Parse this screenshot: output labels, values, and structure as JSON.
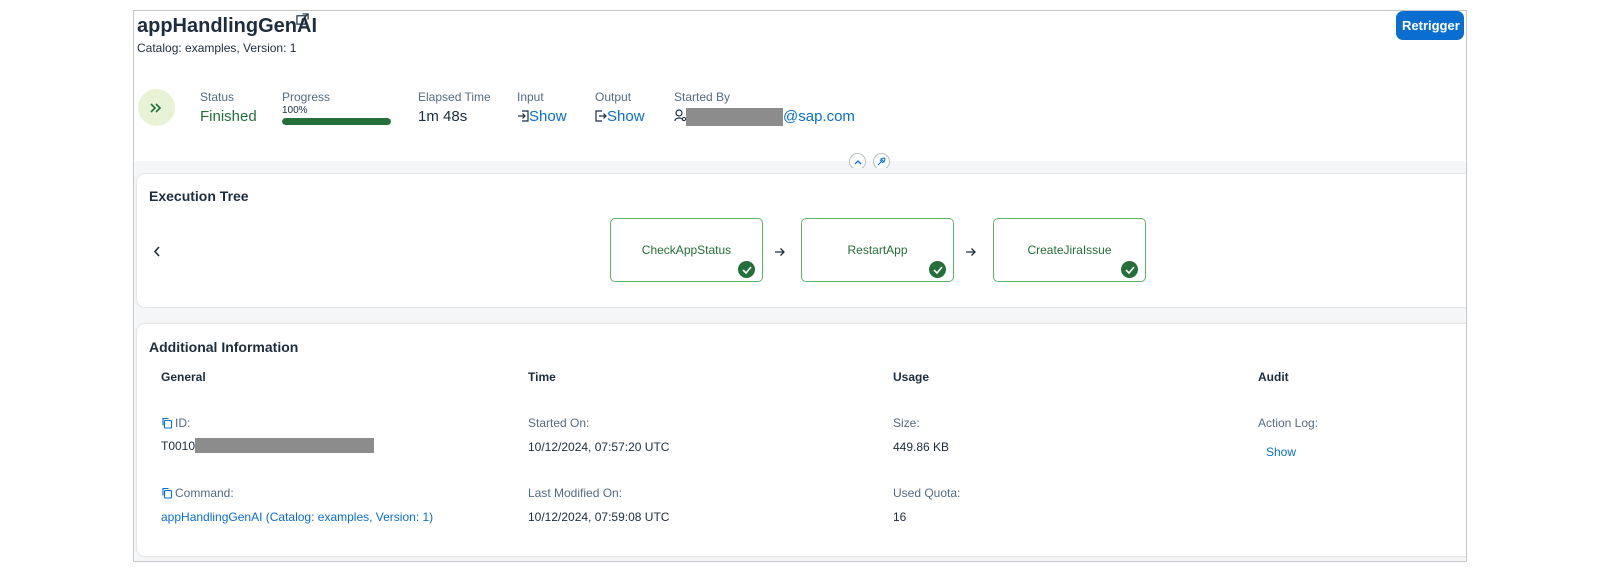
{
  "header": {
    "title": "appHandlingGenAI",
    "subtitle": "Catalog: examples, Version: 1",
    "retrigger_label": "Retrigger"
  },
  "kpis": {
    "status_label": "Status",
    "status_value": "Finished",
    "progress_label": "Progress",
    "progress_text": "100%",
    "progress_fraction": 1.0,
    "elapsed_label": "Elapsed Time",
    "elapsed_value": "1m 48s",
    "input_label": "Input",
    "input_link": "Show",
    "output_label": "Output",
    "output_link": "Show",
    "started_by_label": "Started By",
    "started_by_domain": "@sap.com"
  },
  "execution_tree": {
    "title": "Execution Tree",
    "nodes": [
      "CheckAppStatus",
      "RestartApp",
      "CreateJiraIssue"
    ]
  },
  "additional_info": {
    "title": "Additional Information",
    "columns": {
      "general": "General",
      "time": "Time",
      "usage": "Usage",
      "audit": "Audit"
    },
    "id_label": "ID:",
    "id_prefix": "T0010",
    "command_label": "Command:",
    "command_value": "appHandlingGenAI (Catalog: examples, Version: 1)",
    "started_on_label": "Started On:",
    "started_on_value": "10/12/2024, 07:57:20 UTC",
    "last_modified_label": "Last Modified On:",
    "last_modified_value": "10/12/2024, 07:59:08 UTC",
    "size_label": "Size:",
    "size_value": "449.86 KB",
    "used_quota_label": "Used Quota:",
    "used_quota_value": "16",
    "action_log_label": "Action Log:",
    "action_log_link": "Show"
  },
  "colors": {
    "brand_blue": "#0a6ed1",
    "success_green": "#256f3a",
    "node_border": "#5ab56a"
  },
  "icons": [
    "external-link-icon",
    "double-chevron-right-icon",
    "input-icon",
    "output-icon",
    "user-icon",
    "collapse-icon",
    "pin-icon",
    "chevron-left-icon",
    "check-icon",
    "arrow-right-icon",
    "copy-icon"
  ]
}
